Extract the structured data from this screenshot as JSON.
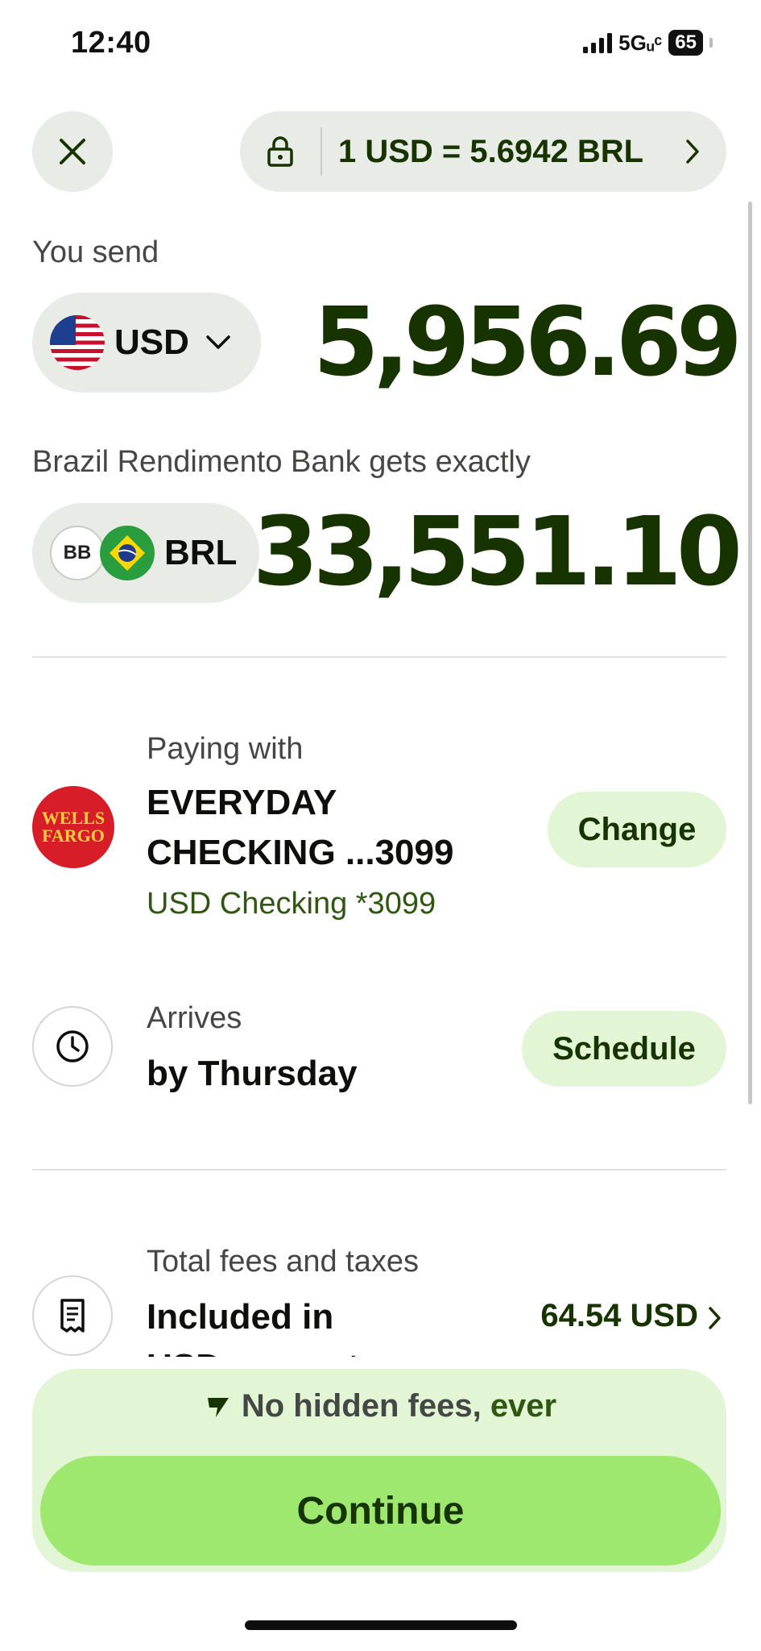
{
  "status_bar": {
    "time": "12:40",
    "network": "5Gᵤᶜ",
    "battery": "65"
  },
  "header": {
    "rate_text": "1 USD = 5.6942 BRL"
  },
  "send": {
    "label": "You send",
    "currency": "USD",
    "amount": "5,956.69"
  },
  "receive": {
    "label": "Brazil Rendimento Bank gets exactly",
    "bank_logo_text": "BB",
    "currency": "BRL",
    "amount": "33,551.10"
  },
  "payment": {
    "label": "Paying with",
    "bank_logo_line1": "WELLS",
    "bank_logo_line2": "FARGO",
    "account_line1": "EVERYDAY",
    "account_line2": "CHECKING ...3099",
    "account_sub": "USD Checking *3099",
    "change_label": "Change"
  },
  "arrival": {
    "label": "Arrives",
    "value": "by Thursday",
    "schedule_label": "Schedule"
  },
  "fees": {
    "label": "Total fees and taxes",
    "value_line1": "Included in",
    "value_line2": "USD amount",
    "amount": "64.54 USD"
  },
  "footer": {
    "no_hidden_fees_black": "No hidden fees,",
    "no_hidden_fees_green": "ever",
    "continue_label": "Continue"
  },
  "colors": {
    "brand_dark": "#163300",
    "brand_green": "#9fe870",
    "light_green": "#e2f6d5",
    "pill_gray": "#e8ebe6"
  },
  "icons": [
    "close-icon",
    "lock-icon",
    "chevron-right-icon",
    "us-flag-icon",
    "chevron-down-icon",
    "bb-bank-icon",
    "brazil-flag-icon",
    "wells-fargo-logo",
    "clock-icon",
    "receipt-icon",
    "wise-logo-icon"
  ]
}
